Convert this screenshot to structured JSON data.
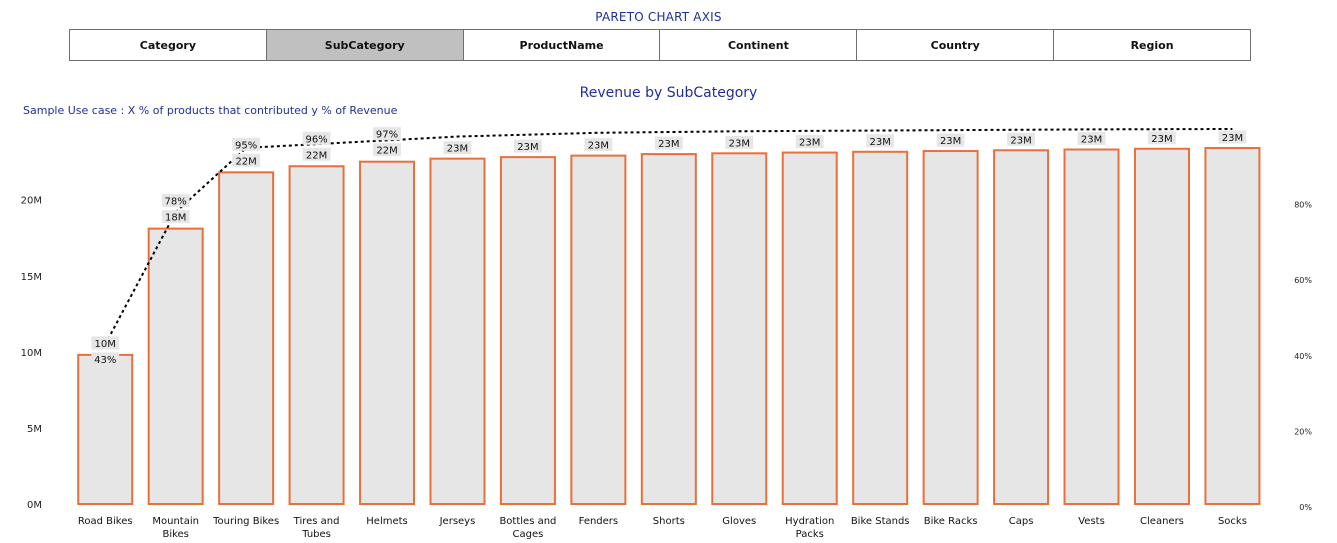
{
  "header": {
    "title": "PARETO CHART AXIS",
    "tabs": [
      {
        "label": "Category",
        "active": false
      },
      {
        "label": "SubCategory",
        "active": true
      },
      {
        "label": "ProductName",
        "active": false
      },
      {
        "label": "Continent",
        "active": false
      },
      {
        "label": "Country",
        "active": false
      },
      {
        "label": "Region",
        "active": false
      }
    ]
  },
  "colors": {
    "bar_fill": "#e6e6e6",
    "bar_stroke": "#e8703a",
    "label_bg": "#e6e6e6",
    "title": "#1f2f9a",
    "active_tab": "#c0c0c0",
    "line": "#000000"
  },
  "chart_data": {
    "type": "bar",
    "title": "Revenue by SubCategory",
    "subtitle": "Sample Use case  : X % of products that contributed y % of Revenue",
    "categories": [
      "Road Bikes",
      "Mountain Bikes",
      "Touring Bikes",
      "Tires and Tubes",
      "Helmets",
      "Jerseys",
      "Bottles and Cages",
      "Fenders",
      "Shorts",
      "Gloves",
      "Hydration Packs",
      "Bike Stands",
      "Bike Racks",
      "Caps",
      "Vests",
      "Cleaners",
      "Socks"
    ],
    "category_lines": [
      [
        "Road Bikes"
      ],
      [
        "Mountain",
        "Bikes"
      ],
      [
        "Touring Bikes"
      ],
      [
        "Tires and",
        "Tubes"
      ],
      [
        "Helmets"
      ],
      [
        "Jerseys"
      ],
      [
        "Bottles and",
        "Cages"
      ],
      [
        "Fenders"
      ],
      [
        "Shorts"
      ],
      [
        "Gloves"
      ],
      [
        "Hydration",
        "Packs"
      ],
      [
        "Bike Stands"
      ],
      [
        "Bike Racks"
      ],
      [
        "Caps"
      ],
      [
        "Vests"
      ],
      [
        "Cleaners"
      ],
      [
        "Socks"
      ]
    ],
    "series": [
      {
        "type": "bar",
        "values": [
          9.8,
          18.1,
          21.8,
          22.2,
          22.5,
          22.7,
          22.8,
          22.9,
          23.0,
          23.05,
          23.1,
          23.15,
          23.2,
          23.25,
          23.3,
          23.35,
          23.4
        ],
        "labels": [
          "10M",
          "18M",
          "22M",
          "22M",
          "22M",
          "23M",
          "23M",
          "23M",
          "23M",
          "23M",
          "23M",
          "23M",
          "23M",
          "23M",
          "23M",
          "23M",
          "23M"
        ]
      },
      {
        "type": "line",
        "axis": "secondary",
        "values": [
          43,
          78,
          95,
          96,
          97,
          98,
          98.5,
          99,
          99.2,
          99.4,
          99.5,
          99.6,
          99.7,
          99.8,
          99.9,
          99.95,
          100
        ],
        "labels": [
          "43%",
          "78%",
          "95%",
          "96%",
          "97%",
          "",
          "",
          "",
          "",
          "",
          "",
          "",
          "",
          "",
          "",
          "",
          ""
        ]
      }
    ],
    "ylim": [
      0,
      23.4
    ],
    "y_ticks": [
      {
        "value": 0,
        "label": "0M"
      },
      {
        "value": 5,
        "label": "5M"
      },
      {
        "value": 10,
        "label": "10M"
      },
      {
        "value": 15,
        "label": "15M"
      },
      {
        "value": 20,
        "label": "20M"
      }
    ],
    "y2lim": [
      0,
      100
    ],
    "y2_ticks": [
      {
        "value": 0,
        "label": "0%"
      },
      {
        "value": 20,
        "label": "20%"
      },
      {
        "value": 40,
        "label": "40%"
      },
      {
        "value": 60,
        "label": "60%"
      },
      {
        "value": 80,
        "label": "80%"
      }
    ],
    "grid": false
  }
}
